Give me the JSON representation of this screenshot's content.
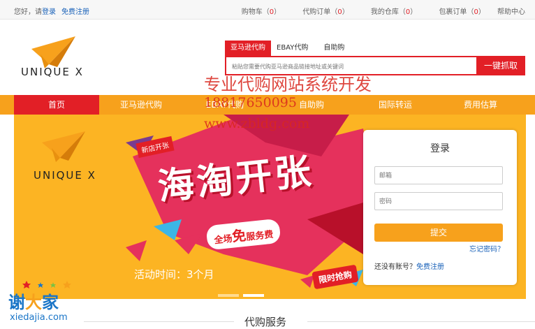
{
  "topbar": {
    "greeting": "您好，请",
    "login": "登录",
    "register": "免费注册",
    "links": [
      {
        "label": "购物车",
        "count": "0"
      },
      {
        "label": "代购订单",
        "count": "0"
      },
      {
        "label": "我的仓库",
        "count": "0"
      },
      {
        "label": "包裹订单",
        "count": "0"
      }
    ],
    "help": "帮助中心"
  },
  "header": {
    "logo_text": "UNIQUE X",
    "tabs": [
      "亚马逊代购",
      "EBAY代购",
      "自助购"
    ],
    "search_placeholder": "粘贴您需要代购亚马逊商品链接地址或关键词",
    "search_button": "一键抓取"
  },
  "watermark": {
    "line1": "专业代购网站系统开发",
    "line2": "18817650095",
    "line3": "www.zbldg.com"
  },
  "nav": [
    "首页",
    "亚马逊代购",
    "EBAY代购",
    "自助购",
    "国际转运",
    "费用估算"
  ],
  "banner": {
    "logo_text": "UNIQUE X",
    "badge": "新店开张",
    "title": "海淘开张",
    "fee_prefix": "全场",
    "fee_big": "免",
    "fee_suffix": "服务费",
    "activity": "活动时间：3个月",
    "limit": "限时抢购"
  },
  "login": {
    "title": "登录",
    "email_placeholder": "邮箱",
    "password_placeholder": "密码",
    "submit": "提交",
    "forgot": "忘记密码？",
    "no_account": "还没有账号？",
    "register": "免费注册"
  },
  "section": {
    "title": "代购服务"
  },
  "site_logo": {
    "cn_left": "谢",
    "cn_mid": "大",
    "cn_right": "家",
    "en": "xiedajia.com"
  },
  "colors": {
    "primary": "#e21f26",
    "accent": "#f7a11c",
    "link": "#1a62b9"
  }
}
